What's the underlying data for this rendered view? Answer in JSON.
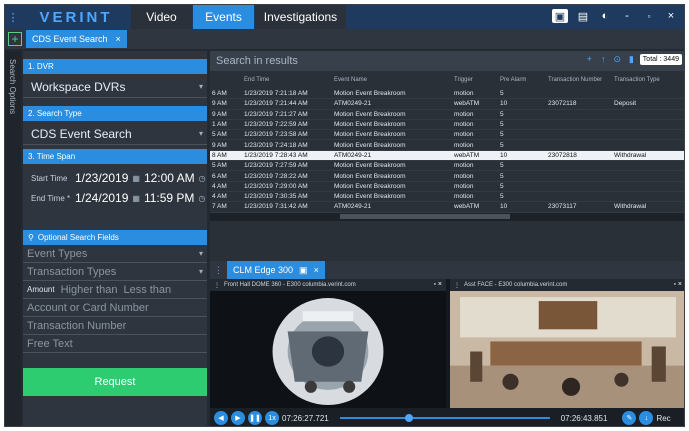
{
  "app": {
    "logo": "VERINT",
    "nav": [
      "Video",
      "Events",
      "Investigations"
    ],
    "active_nav": "Events"
  },
  "doc_tab": {
    "label": "CDS Event Search",
    "close": "×"
  },
  "vertical_tab": "Search Options",
  "left": {
    "dvr": {
      "title": "1. DVR",
      "value": "Workspace DVRs"
    },
    "search_type": {
      "title": "2. Search Type",
      "value": "CDS Event Search"
    },
    "time_span": {
      "title": "3. Time Span",
      "start_label": "Start Time",
      "start_date": "1/23/2019",
      "start_time": "12:00 AM",
      "end_label": "End Time *",
      "end_date": "1/24/2019",
      "end_time": "11:59 PM"
    },
    "optional": {
      "title": "Optional Search Fields",
      "event_types": "Event Types",
      "transaction_types": "Transaction Types",
      "amount_label": "Amount",
      "higher_than": "Higher than",
      "less_than": "Less than",
      "account": "Account or Card Number",
      "transaction_number": "Transaction Number",
      "free_text": "Free Text"
    },
    "request_label": "Request"
  },
  "results": {
    "search_placeholder": "Search in results",
    "total": "Total : 3449",
    "columns": [
      "",
      "End Time",
      "Event Name",
      "Trigger",
      "Pre Alarm",
      "Transaction Number",
      "Transaction Type"
    ],
    "rows": [
      [
        "6 AM",
        "1/23/2019 7:21:18 AM",
        "Motion Event Breakroom",
        "motion",
        "5",
        "",
        ""
      ],
      [
        "9 AM",
        "1/23/2019 7:21:44 AM",
        "ATM0249-21",
        "webATM",
        "10",
        "23072118",
        "Deposit"
      ],
      [
        "9 AM",
        "1/23/2019 7:21:27 AM",
        "Motion Event Breakroom",
        "motion",
        "5",
        "",
        ""
      ],
      [
        "1 AM",
        "1/23/2019 7:22:59 AM",
        "Motion Event Breakroom",
        "motion",
        "5",
        "",
        ""
      ],
      [
        "5 AM",
        "1/23/2019 7:23:58 AM",
        "Motion Event Breakroom",
        "motion",
        "5",
        "",
        ""
      ],
      [
        "9 AM",
        "1/23/2019 7:24:18 AM",
        "Motion Event Breakroom",
        "motion",
        "5",
        "",
        ""
      ],
      [
        "8 AM",
        "1/23/2019 7:28:43 AM",
        "ATM0249-21",
        "webATM",
        "10",
        "23072818",
        "Withdrawal"
      ],
      [
        "5 AM",
        "1/23/2019 7:27:59 AM",
        "Motion Event Breakroom",
        "motion",
        "5",
        "",
        ""
      ],
      [
        "6 AM",
        "1/23/2019 7:28:22 AM",
        "Motion Event Breakroom",
        "motion",
        "5",
        "",
        ""
      ],
      [
        "4 AM",
        "1/23/2019 7:29:00 AM",
        "Motion Event Breakroom",
        "motion",
        "5",
        "",
        ""
      ],
      [
        "4 AM",
        "1/23/2019 7:30:35 AM",
        "Motion Event Breakroom",
        "motion",
        "5",
        "",
        ""
      ],
      [
        "7 AM",
        "1/23/2019 7:31:42 AM",
        "ATM0249-21",
        "webATM",
        "10",
        "23073117",
        "Withdrawal"
      ]
    ],
    "selected_row": 6
  },
  "video": {
    "tab_label": "CLM Edge 300",
    "left_pane": "Front Hall DOME 360 - E300 columbia.verint.com",
    "right_pane": "Asst FACE - E300 columbia.verint.com",
    "time_start": "07:26:27.721",
    "time_end": "07:26:43.851",
    "playback_position": 0.33,
    "speed_label": "1x",
    "rec_label": "Rec"
  },
  "colors": {
    "accent": "#2b8de0",
    "request": "#2ecc71"
  }
}
